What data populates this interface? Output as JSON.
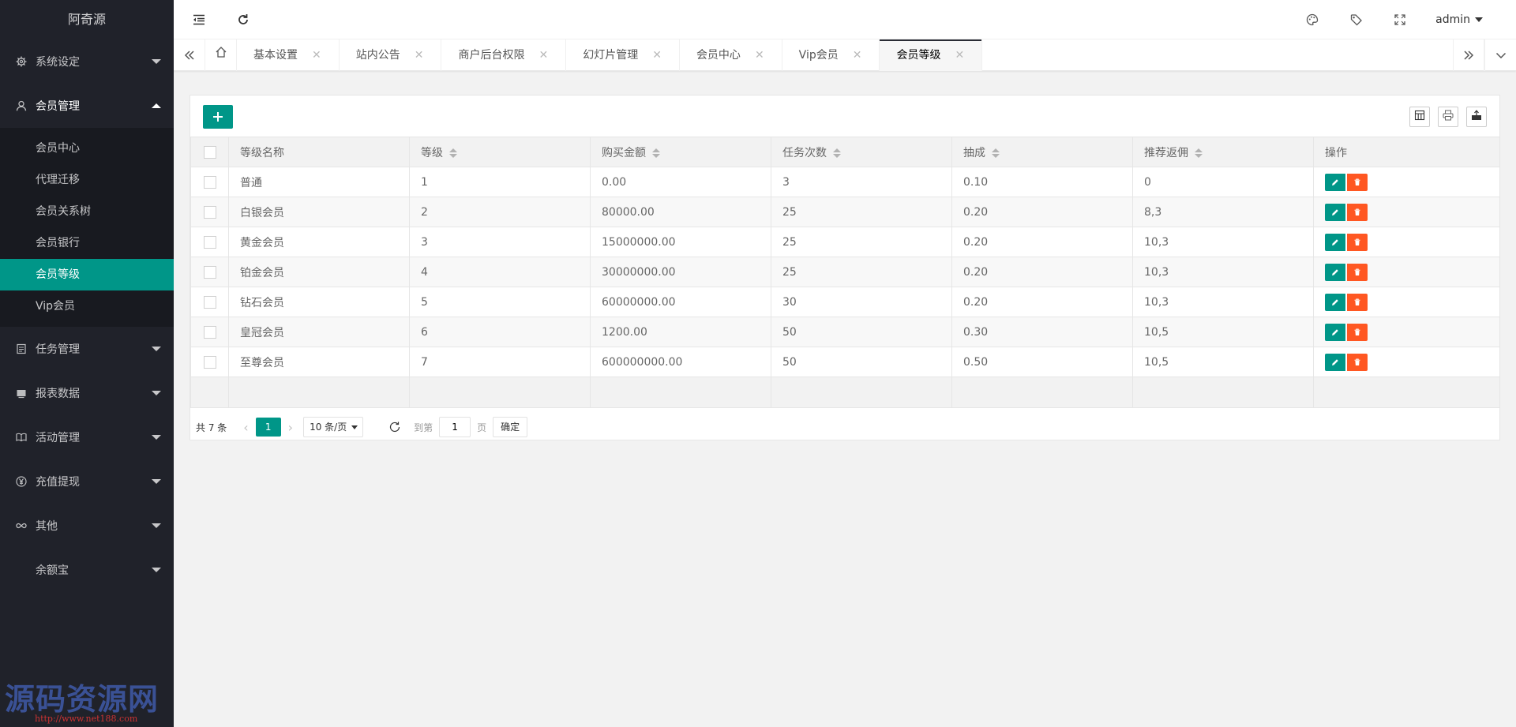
{
  "sidebar": {
    "logo": "阿奇源",
    "groups": [
      {
        "label": "系统设定",
        "icon": "gear-icon"
      },
      {
        "label": "会员管理",
        "icon": "user-icon"
      },
      {
        "label": "任务管理",
        "icon": "task-icon"
      },
      {
        "label": "报表数据",
        "icon": "report-icon"
      },
      {
        "label": "活动管理",
        "icon": "book-icon"
      },
      {
        "label": "充值提现",
        "icon": "yen-icon"
      },
      {
        "label": "其他",
        "icon": "infinity-icon"
      },
      {
        "label": "余额宝",
        "icon": ""
      }
    ],
    "member_sub": [
      "会员中心",
      "代理迁移",
      "会员关系树",
      "会员银行",
      "会员等级",
      "Vip会员"
    ],
    "watermark": {
      "main": "源码资源网",
      "url": "http://www.net188.com"
    }
  },
  "header": {
    "user": "admin",
    "icons": [
      "indent-icon",
      "refresh-icon",
      "theme-icon",
      "tag-icon",
      "fullscreen-icon"
    ]
  },
  "tabs": [
    "基本设置",
    "站内公告",
    "商户后台权限",
    "幻灯片管理",
    "会员中心",
    "Vip会员",
    "会员等级"
  ],
  "active_tab": "会员等级",
  "table": {
    "columns": [
      "等级名称",
      "等级",
      "购买金额",
      "任务次数",
      "抽成",
      "推荐返佣",
      "操作"
    ],
    "rows": [
      [
        "普通",
        "1",
        "0.00",
        "3",
        "0.10",
        "0"
      ],
      [
        "白银会员",
        "2",
        "80000.00",
        "25",
        "0.20",
        "8,3"
      ],
      [
        "黄金会员",
        "3",
        "15000000.00",
        "25",
        "0.20",
        "10,3"
      ],
      [
        "铂金会员",
        "4",
        "30000000.00",
        "25",
        "0.20",
        "10,3"
      ],
      [
        "钻石会员",
        "5",
        "60000000.00",
        "30",
        "0.20",
        "10,3"
      ],
      [
        "皇冠会员",
        "6",
        "1200.00",
        "50",
        "0.30",
        "10,5"
      ],
      [
        "至尊会员",
        "7",
        "600000000.00",
        "50",
        "0.50",
        "10,5"
      ]
    ]
  },
  "pager": {
    "total": "共 7 条",
    "current": "1",
    "limit": "10 条/页",
    "goto_label": "到第",
    "goto_value": "1",
    "page_unit": "页",
    "confirm": "确定"
  },
  "colors": {
    "accent": "#009688",
    "danger": "#ff5722",
    "sidebar": "#20222a"
  }
}
